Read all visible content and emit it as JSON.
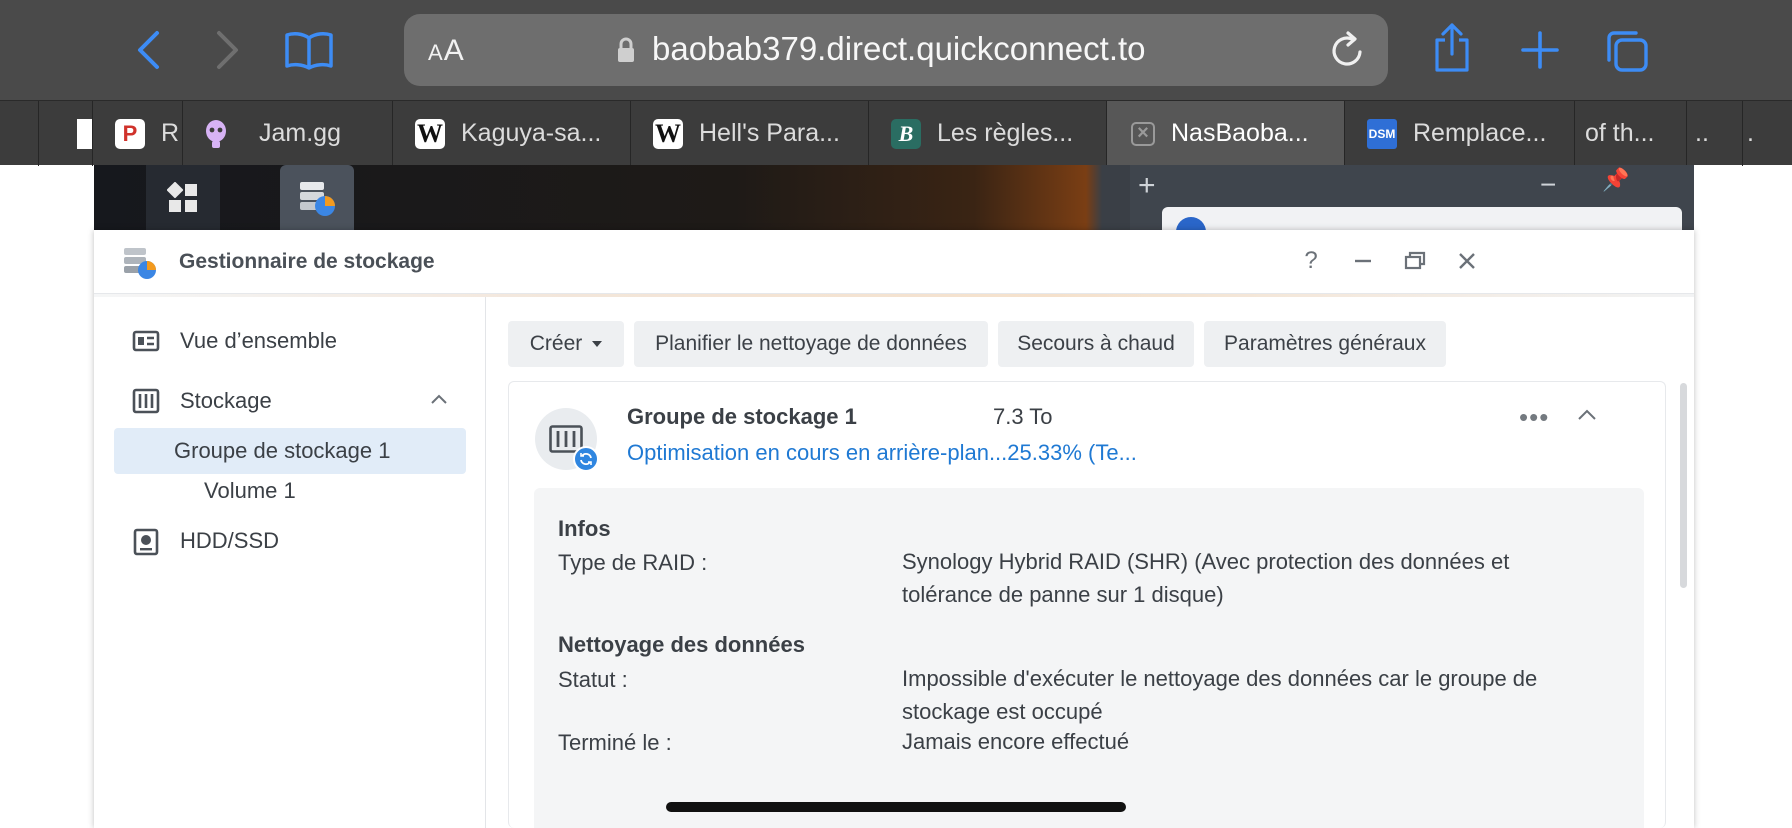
{
  "browser": {
    "address": {
      "text_size_label_small": "A",
      "text_size_label_big": "A",
      "url": "baobab379.direct.quickconnect.to"
    },
    "tabs": [
      {
        "label": "",
        "icon": "museum-icon"
      },
      {
        "label": "R",
        "icon": "producthunt-icon"
      },
      {
        "label": "Jam.gg",
        "icon": "alien-icon"
      },
      {
        "label": "Kaguya-sa...",
        "icon": "wikipedia-icon"
      },
      {
        "label": "Hell's Para...",
        "icon": "wikipedia-icon"
      },
      {
        "label": "Les règles...",
        "icon": "beta-icon"
      },
      {
        "label": "NasBaoba...",
        "icon": "close-icon"
      },
      {
        "label": "Remplace...",
        "icon": "dsm-icon"
      },
      {
        "label": "of th...",
        "icon": ""
      },
      {
        "label": "..",
        "icon": ""
      },
      {
        "label": ".",
        "icon": ""
      }
    ],
    "favicons": {
      "wiki": "W",
      "ph": "P",
      "beta": "B",
      "dsm": "DSM",
      "close": "×"
    }
  },
  "window": {
    "title": "Gestionnaire de stockage",
    "controls": {
      "help": "?"
    }
  },
  "sidebar": {
    "items": [
      {
        "label": "Vue d’ensemble"
      },
      {
        "label": "Stockage"
      },
      {
        "label": "Groupe de stockage 1"
      },
      {
        "label": "Volume 1"
      },
      {
        "label": "HDD/SSD"
      }
    ]
  },
  "toolbar": {
    "create": "Créer",
    "schedule_scrub": "Planifier le nettoyage de données",
    "hot_spare": "Secours à chaud",
    "global_settings": "Paramètres généraux"
  },
  "pool": {
    "name": "Groupe de stockage 1",
    "size": "7.3 To",
    "status": "Optimisation en cours en arrière-plan...25.33% (Te...",
    "more": "•••",
    "infos": {
      "section": "Infos",
      "raid_label": "Type de RAID :",
      "raid_value": "Synology Hybrid RAID (SHR) (Avec protection des données et tolérance de panne sur 1 disque)"
    },
    "scrub": {
      "section": "Nettoyage des données",
      "status_label": "Statut :",
      "status_value": "Impossible d'exécuter le nettoyage des données car le groupe de stockage est occupé",
      "done_label": "Terminé le :",
      "done_value": "Jamais encore effectué"
    }
  },
  "colors": {
    "accent": "#1f79d3",
    "selected": "#e1ecf8",
    "safari_blue": "#3d8cf5"
  }
}
